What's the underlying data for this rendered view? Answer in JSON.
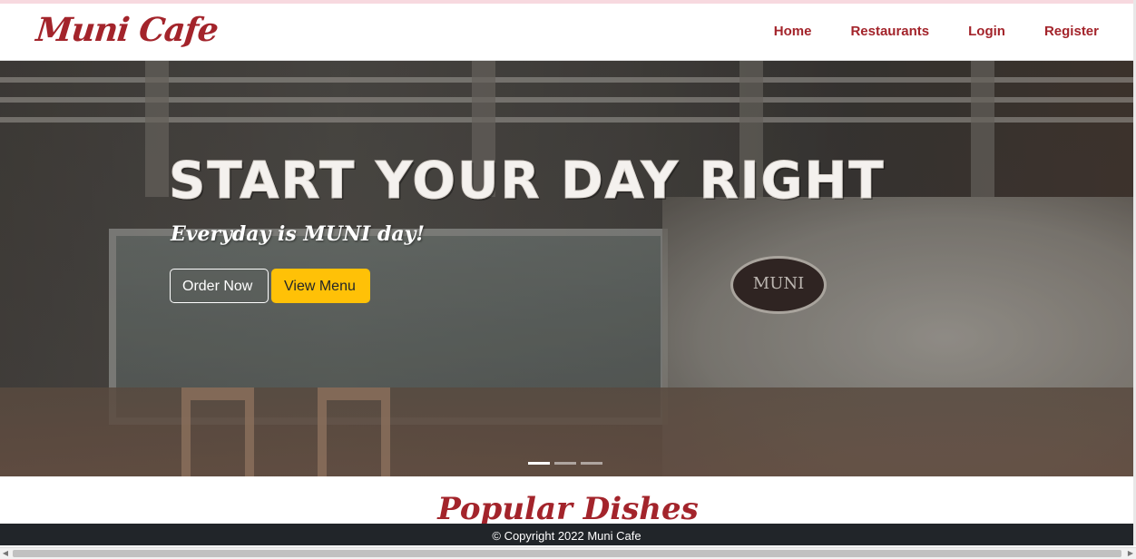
{
  "brand": {
    "name": "Muni Cafe"
  },
  "nav": {
    "items": [
      {
        "label": "Home"
      },
      {
        "label": "Restaurants"
      },
      {
        "label": "Login"
      },
      {
        "label": "Register"
      }
    ]
  },
  "hero": {
    "title": "START YOUR DAY RIGHT",
    "subtitle": "Everyday is MUNI day!",
    "order_button": "Order Now",
    "menu_button": "View Menu",
    "mural_sign": "MUNI",
    "active_slide": 1,
    "slide_count": 3
  },
  "sections": {
    "popular_title": "Popular Dishes"
  },
  "footer": {
    "copyright": "© Copyright 2022 Muni Cafe"
  },
  "colors": {
    "accent": "#a3242b",
    "button_yellow": "#ffc107",
    "footer_bg": "#212529"
  },
  "icons": {
    "scroll_left": "chevron-left-icon",
    "scroll_right": "chevron-right-icon"
  }
}
